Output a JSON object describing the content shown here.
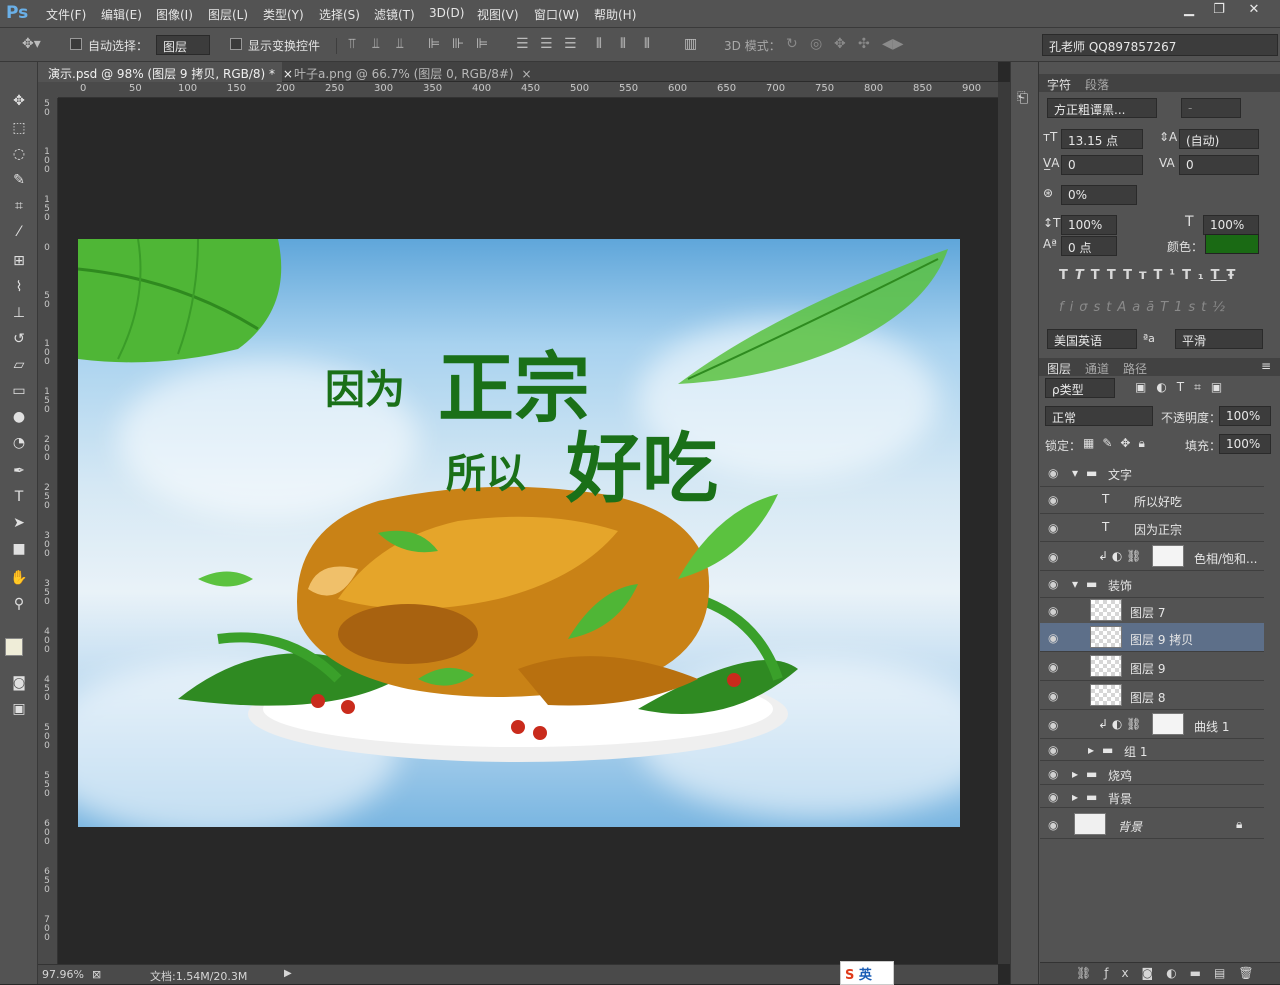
{
  "app": {
    "logo": "Ps"
  },
  "menu": [
    "文件(F)",
    "编辑(E)",
    "图像(I)",
    "图层(L)",
    "类型(Y)",
    "选择(S)",
    "滤镜(T)",
    "3D(D)",
    "视图(V)",
    "窗口(W)",
    "帮助(H)"
  ],
  "window": {
    "minimize": "▁",
    "restore": "❐",
    "close": "✕"
  },
  "options": {
    "auto_select_label": "自动选择：",
    "auto_select_target": "图层",
    "show_transform_label": "显示变换控件",
    "mode_3d_label": "3D 模式：",
    "profile": "孔老师 QQ897857267"
  },
  "tabs": [
    {
      "label": "演示.psd @ 98% (图层 9 拷贝, RGB/8) *",
      "close": "×"
    },
    {
      "label": "叶子a.png @ 66.7% (图层 0, RGB/8#)",
      "close": "×"
    }
  ],
  "ruler": {
    "h": [
      "0",
      "50",
      "100",
      "150",
      "200",
      "250",
      "300",
      "350",
      "400",
      "450",
      "500",
      "550",
      "600",
      "650",
      "700",
      "750",
      "800",
      "850",
      "900"
    ],
    "v": [
      "5 0",
      "1 0 0",
      "1 5 0",
      "0",
      "5 0",
      "1 0 0",
      "1 5 0",
      "2 0 0",
      "2 5 0",
      "3 0 0",
      "3 5 0",
      "4 0 0",
      "4 5 0",
      "5 0 0",
      "5 5 0",
      "6 0 0",
      "6 5 0",
      "7 0 0"
    ]
  },
  "canvas": {
    "line1_small": "因为",
    "line1_big": "正宗",
    "line2_small": "所以",
    "line2_big": "好吃"
  },
  "status": {
    "zoom": "97.96%",
    "doc": "文档:1.54M/20.3M",
    "ime": "英"
  },
  "character_panel": {
    "tabs": [
      "字符",
      "段落"
    ],
    "font_family": "方正粗谭黑...",
    "font_style": "-",
    "size": "13.15 点",
    "leading": "(自动)",
    "kerning": "0",
    "tracking": "0",
    "scale_tsume": "0%",
    "v_scale": "100%",
    "h_scale": "100%",
    "baseline": "0 点",
    "color_label": "颜色：",
    "color": "#1a6a14",
    "styles": [
      "T",
      "T",
      "TT",
      "Tт",
      "T¹",
      "T₁",
      "T",
      "Ŧ"
    ],
    "opentype": [
      "fi",
      "σ",
      "st",
      "A",
      "aā",
      "T",
      "1st",
      "½"
    ],
    "language": "美国英语",
    "aa_label": "ªa",
    "antialias": "平滑"
  },
  "layers_panel": {
    "tabs": [
      "图层",
      "通道",
      "路径"
    ],
    "filter": "ρ类型",
    "blend_mode": "正常",
    "opacity_label": "不透明度：",
    "opacity": "100%",
    "lock_label": "锁定：",
    "fill_label": "填充：",
    "fill": "100%",
    "layers": [
      {
        "name": "文字",
        "kind": "group-open",
        "indent": 0
      },
      {
        "name": "所以好吃",
        "kind": "text",
        "indent": 1
      },
      {
        "name": "因为正宗",
        "kind": "text",
        "indent": 1
      },
      {
        "name": "色相/饱和...",
        "kind": "adjust",
        "indent": 1
      },
      {
        "name": "装饰",
        "kind": "group-open",
        "indent": 0
      },
      {
        "name": "图层 7",
        "kind": "pixel",
        "indent": 1
      },
      {
        "name": "图层 9 拷贝",
        "kind": "pixel",
        "indent": 1,
        "selected": true
      },
      {
        "name": "图层 9",
        "kind": "pixel",
        "indent": 1
      },
      {
        "name": "图层 8",
        "kind": "pixel",
        "indent": 1
      },
      {
        "name": "曲线 1",
        "kind": "adjust",
        "indent": 1
      },
      {
        "name": "组 1",
        "kind": "group-closed",
        "indent": 1
      },
      {
        "name": "烧鸡",
        "kind": "group-closed",
        "indent": 0
      },
      {
        "name": "背景",
        "kind": "group-closed",
        "indent": 0
      },
      {
        "name": "背景",
        "kind": "background",
        "indent": 0
      }
    ]
  }
}
